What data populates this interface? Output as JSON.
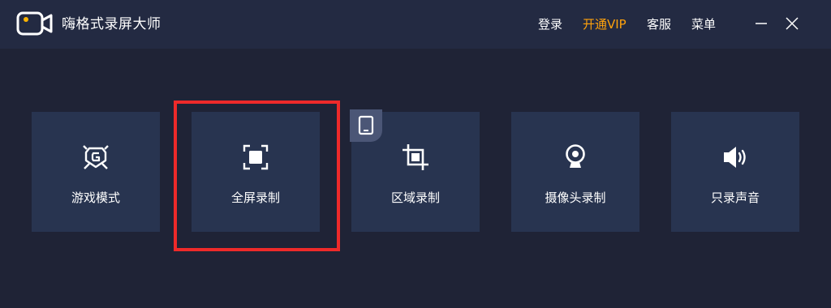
{
  "app": {
    "title": "嗨格式录屏大师",
    "logo_icon": "camera-logo-icon"
  },
  "header": {
    "login_label": "登录",
    "vip_label": "开通VIP",
    "service_label": "客服",
    "menu_label": "菜单",
    "minimize_icon": "minimize-icon",
    "close_icon": "close-icon"
  },
  "modes": {
    "game": {
      "label": "游戏模式",
      "icon": "gamepad-shield-icon"
    },
    "fullscreen": {
      "label": "全屏录制",
      "icon": "fullscreen-icon",
      "highlighted": true
    },
    "region": {
      "label": "区域录制",
      "icon": "crop-icon",
      "badge_icon": "tablet-icon"
    },
    "webcam": {
      "label": "摄像头录制",
      "icon": "webcam-icon"
    },
    "audio": {
      "label": "只录声音",
      "icon": "speaker-icon"
    }
  },
  "colors": {
    "background": "#1f2336",
    "titlebar": "#232a42",
    "card": "#283450",
    "vip_accent": "#ffa20c",
    "logo_accent": "#ffb400",
    "highlight_border": "#ee2a2a"
  }
}
